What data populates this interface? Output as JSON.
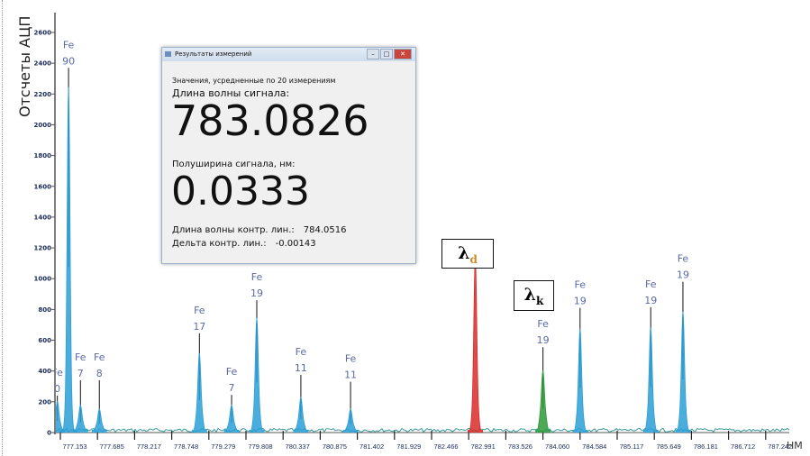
{
  "chart_data": {
    "type": "line",
    "title": "",
    "ylabel": "Отсчеты АЦП",
    "xlabel": "НМ",
    "ylim": [
      0,
      2700
    ],
    "yticks": [
      0,
      200,
      400,
      600,
      800,
      1000,
      1200,
      1400,
      1600,
      1800,
      2000,
      2200,
      2400,
      2600
    ],
    "xticks": [
      "777.153",
      "777.685",
      "778.217",
      "778.748",
      "779.279",
      "779.808",
      "780.337",
      "780.875",
      "781.402",
      "781.929",
      "782.466",
      "782.991",
      "783.526",
      "784.060",
      "784.584",
      "785.117",
      "785.649",
      "786.181",
      "786.712",
      "787.242"
    ],
    "xlim": [
      777.15,
      787.6
    ],
    "baseline": 15,
    "peaks": [
      {
        "wavelength": 777.11,
        "intensity": 150,
        "marker": 240,
        "element": "Fe",
        "number": "0",
        "color": "#2c9fd6"
      },
      {
        "wavelength": 777.27,
        "intensity": 2150,
        "marker": 2370,
        "element": "Fe",
        "number": "90",
        "color": "#2c9fd6"
      },
      {
        "wavelength": 777.44,
        "intensity": 130,
        "marker": 340,
        "element": "Fe",
        "number": "7",
        "color": "#2c9fd6"
      },
      {
        "wavelength": 777.71,
        "intensity": 110,
        "marker": 340,
        "element": "Fe",
        "number": "8",
        "color": "#2c9fd6"
      },
      {
        "wavelength": 779.14,
        "intensity": 420,
        "marker": 645,
        "element": "Fe",
        "number": "17",
        "color": "#2c9fd6"
      },
      {
        "wavelength": 779.6,
        "intensity": 130,
        "marker": 245,
        "element": "Fe",
        "number": "7",
        "color": "#2c9fd6"
      },
      {
        "wavelength": 779.96,
        "intensity": 650,
        "marker": 860,
        "element": "Fe",
        "number": "19",
        "color": "#2c9fd6"
      },
      {
        "wavelength": 780.59,
        "intensity": 170,
        "marker": 375,
        "element": "Fe",
        "number": "11",
        "color": "#2c9fd6"
      },
      {
        "wavelength": 781.3,
        "intensity": 110,
        "marker": 330,
        "element": "Fe",
        "number": "11",
        "color": "#2c9fd6"
      },
      {
        "wavelength": 783.083,
        "intensity": 1050,
        "marker": null,
        "element": "",
        "number": "",
        "color": "#d92b2b"
      },
      {
        "wavelength": 784.05,
        "intensity": 310,
        "marker": 555,
        "element": "Fe",
        "number": "19",
        "color": "#2e9a3a"
      },
      {
        "wavelength": 784.58,
        "intensity": 580,
        "marker": 810,
        "element": "Fe",
        "number": "19",
        "color": "#2c9fd6"
      },
      {
        "wavelength": 785.59,
        "intensity": 590,
        "marker": 815,
        "element": "Fe",
        "number": "19",
        "color": "#2c9fd6"
      },
      {
        "wavelength": 786.05,
        "intensity": 690,
        "marker": 980,
        "element": "Fe",
        "number": "19",
        "color": "#2c9fd6"
      }
    ],
    "annotations": {
      "lambda_d": "λ",
      "lambda_d_sub": "d",
      "lambda_k": "λ",
      "lambda_k_sub": "k"
    }
  },
  "dialog": {
    "title": "Результаты измерений",
    "averaged_note": "Значения, усредненные по 20 измерениям",
    "wavelength_label": "Длина волны сигнала:",
    "wavelength_value": "783.0826",
    "halfwidth_label": "Полуширина сигнала, нм:",
    "halfwidth_value": "0.0333",
    "control_wavelength_label": "Длина волны контр. лин.:",
    "control_wavelength_value": "784.0516",
    "control_delta_label": "Дельта контр. лин.:",
    "control_delta_value": "-0.00143",
    "minimize": "–",
    "maximize": "□",
    "close": "✕"
  },
  "colors": {
    "baseline": "#3a9a9a",
    "axis": "#555",
    "tick_label": "#1a2a5a",
    "peak_label": "#5a6aa8"
  }
}
